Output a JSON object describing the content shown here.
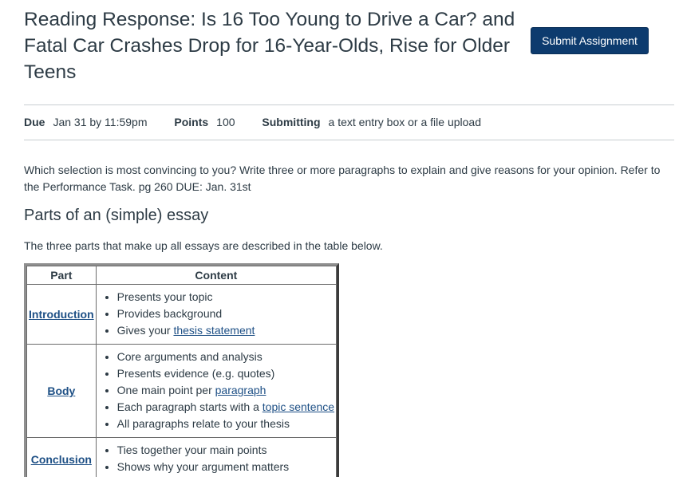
{
  "assignment": {
    "title": "Reading Response: Is 16 Too Young to Drive a Car? and Fatal Car Crashes Drop for 16-Year-Olds, Rise for Older Teens",
    "submit_label": "Submit Assignment"
  },
  "details": {
    "due_label": "Due",
    "due_value": "Jan 31 by 11:59pm",
    "points_label": "Points",
    "points_value": "100",
    "submitting_label": "Submitting",
    "submitting_value": "a text entry box or a file upload"
  },
  "description": "Which selection is most convincing to you? Write three or more paragraphs to explain and give reasons for your opinion. Refer to the Performance Task. pg 260 DUE: Jan. 31st",
  "essay": {
    "heading": "Parts of an (simple) essay",
    "intro": "The three parts that make up all essays are described in the table below.",
    "columns": [
      "Part",
      "Content"
    ],
    "rows": [
      {
        "part": "Introduction",
        "items": [
          {
            "text": "Presents your topic"
          },
          {
            "text": "Provides background"
          },
          {
            "text": "Gives your ",
            "link": "thesis statement"
          }
        ]
      },
      {
        "part": "Body",
        "items": [
          {
            "text": "Core arguments and analysis"
          },
          {
            "text": "Presents evidence (e.g. quotes)"
          },
          {
            "text": "One main point per ",
            "link": "paragraph"
          },
          {
            "text": "Each paragraph starts with a ",
            "link": "topic sentence"
          },
          {
            "text": "All paragraphs relate to your thesis"
          }
        ]
      },
      {
        "part": "Conclusion",
        "items": [
          {
            "text": "Ties together your main points"
          },
          {
            "text": "Shows why your argument matters"
          }
        ]
      }
    ]
  }
}
